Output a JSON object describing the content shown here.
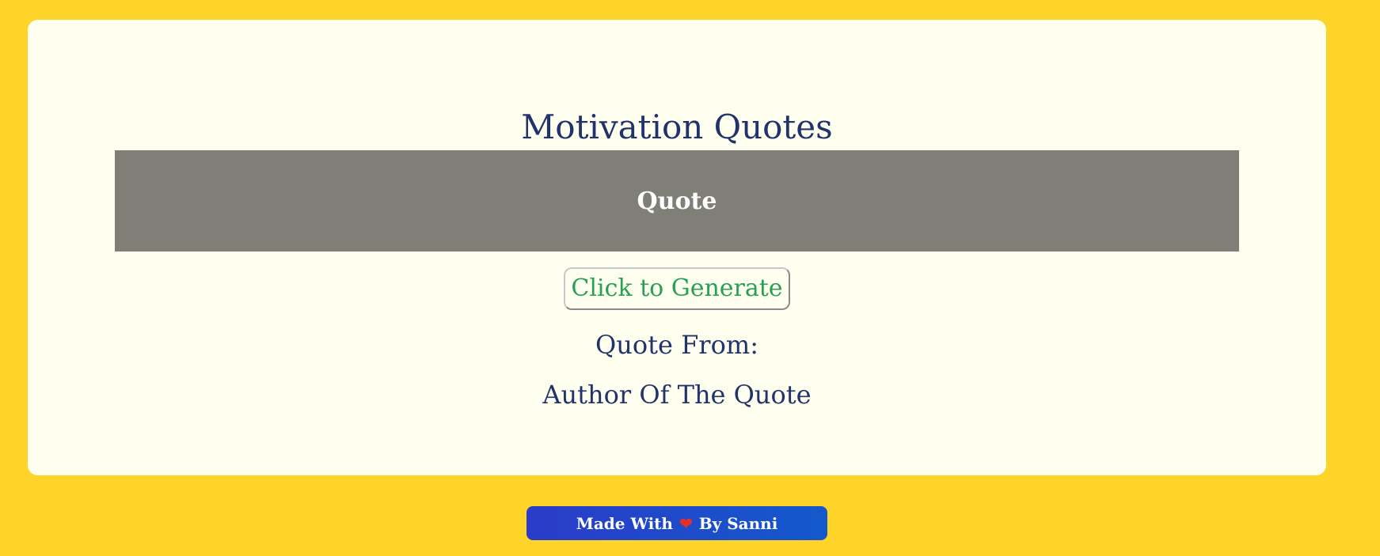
{
  "app": {
    "title": "Motivation Quotes"
  },
  "quote": {
    "text": "Quote"
  },
  "controls": {
    "generate_label": "Click to Generate"
  },
  "attribution": {
    "label": "Quote From:",
    "author": "Author Of The Quote"
  },
  "footer": {
    "prefix": "Made With",
    "heart_icon": "❤",
    "suffix": "By Sanni"
  },
  "colors": {
    "background": "#ffd42a",
    "card": "#fffff0",
    "quote_box": "#807f77",
    "heading": "#22326b",
    "button_text": "#27a053",
    "footer_badge": "#2b3cc8"
  }
}
